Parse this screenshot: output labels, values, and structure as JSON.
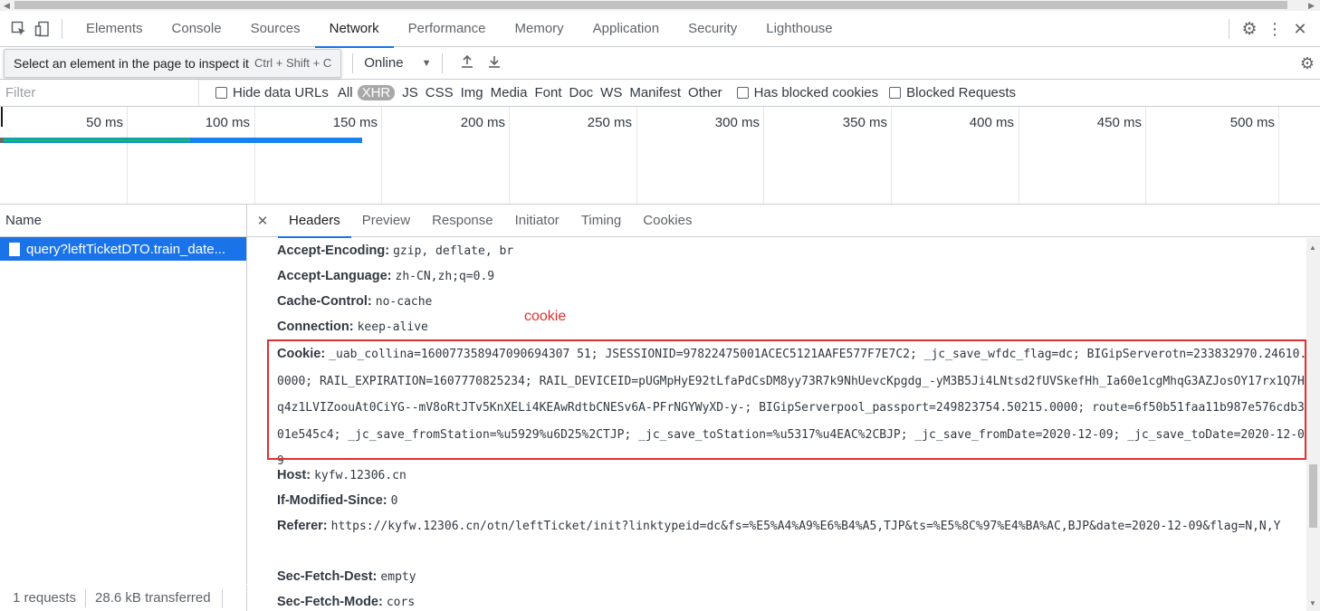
{
  "tabs": {
    "items": [
      "Elements",
      "Console",
      "Sources",
      "Network",
      "Performance",
      "Memory",
      "Application",
      "Security",
      "Lighthouse"
    ],
    "active": "Network"
  },
  "toolbar": {
    "inspect_tooltip": "Select an element in the page to inspect it",
    "inspect_shortcut": "Ctrl + Shift + C",
    "throttling": "Online"
  },
  "filter": {
    "placeholder": "Filter",
    "hide_data_urls": "Hide data URLs",
    "types": [
      "All",
      "XHR",
      "JS",
      "CSS",
      "Img",
      "Media",
      "Font",
      "Doc",
      "WS",
      "Manifest",
      "Other"
    ],
    "active_type": "XHR",
    "has_blocked_cookies": "Has blocked cookies",
    "blocked_requests": "Blocked Requests"
  },
  "overview": {
    "ticks": [
      "50 ms",
      "100 ms",
      "150 ms",
      "200 ms",
      "250 ms",
      "300 ms",
      "350 ms",
      "400 ms",
      "450 ms",
      "500 ms"
    ]
  },
  "requests": {
    "column_name": "Name",
    "selected": "query?leftTicketDTO.train_date...",
    "count": "1 requests",
    "transferred": "28.6 kB transferred"
  },
  "detail_tabs": {
    "items": [
      "Headers",
      "Preview",
      "Response",
      "Initiator",
      "Timing",
      "Cookies"
    ],
    "active": "Headers"
  },
  "headers": {
    "accept_encoding": {
      "name": "Accept-Encoding:",
      "value": "gzip, deflate, br"
    },
    "accept_language": {
      "name": "Accept-Language:",
      "value": "zh-CN,zh;q=0.9"
    },
    "cache_control": {
      "name": "Cache-Control:",
      "value": "no-cache"
    },
    "connection": {
      "name": "Connection:",
      "value": "keep-alive"
    },
    "cookie": {
      "name": "Cookie:",
      "value": "_uab_collina=160077358947090694307 51; JSESSIONID=97822475001ACEC5121AAFE577F7E7C2; _jc_save_wfdc_flag=dc; BIGipServerotn=233832970.24610.0000; RAIL_EXPIRATION=1607770825234; RAIL_DEVICEID=pUGMpHyE92tLfaPdCsDM8yy73R7k9NhUevcKpgdg_-yM3B5Ji4LNtsd2fUVSkefHh_Ia60e1cgMhqG3AZJosOY17rx1Q7Hq4z1LVIZoouAt0CiYG--mV8oRtJTv5KnXELi4KEAwRdtbCNESv6A-PFrNGYWyXD-y-; BIGipServerpool_passport=249823754.50215.0000; route=6f50b51faa11b987e576cdb301e545c4; _jc_save_fromStation=%u5929%u6D25%2CTJP; _jc_save_toStation=%u5317%u4EAC%2CBJP; _jc_save_fromDate=2020-12-09; _jc_save_toDate=2020-12-09"
    },
    "host": {
      "name": "Host:",
      "value": "kyfw.12306.cn"
    },
    "if_modified_since": {
      "name": "If-Modified-Since:",
      "value": "0"
    },
    "referer": {
      "name": "Referer:",
      "value": "https://kyfw.12306.cn/otn/leftTicket/init?linktypeid=dc&fs=%E5%A4%A9%E6%B4%A5,TJP&ts=%E5%8C%97%E4%BA%AC,BJP&date=2020-12-09&flag=N,N,Y"
    },
    "sec_fetch_dest": {
      "name": "Sec-Fetch-Dest:",
      "value": "empty"
    },
    "sec_fetch_mode": {
      "name": "Sec-Fetch-Mode:",
      "value": "cors"
    }
  },
  "annotation": "cookie",
  "colors": {
    "accent": "#1a73e8",
    "annotation_red": "#e03030",
    "selected_row": "#1a73e8"
  }
}
